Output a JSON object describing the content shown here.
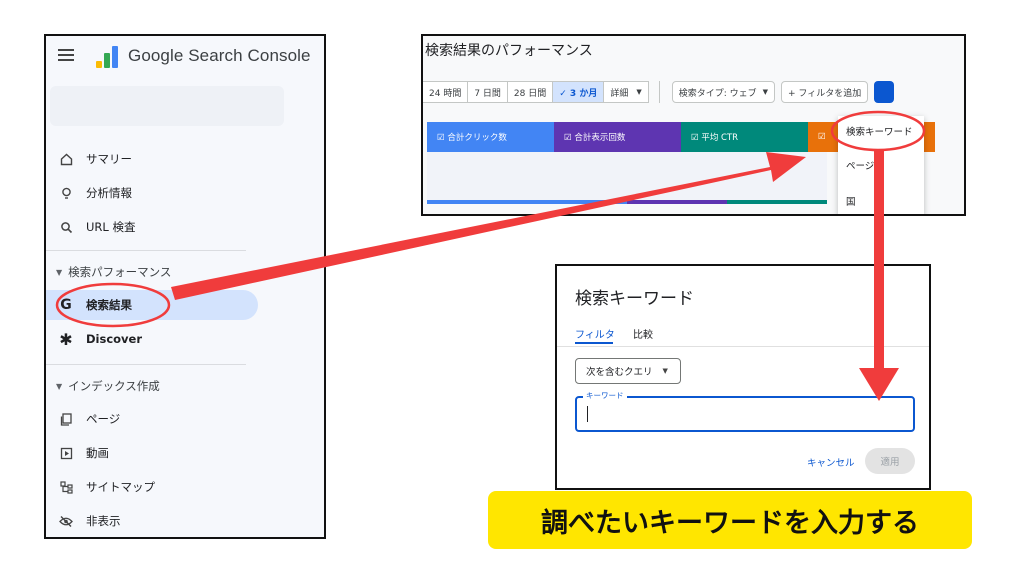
{
  "sidebar": {
    "brand": "Google Search Console",
    "items": [
      {
        "label": "サマリー",
        "icon": "home-icon"
      },
      {
        "label": "分析情報",
        "icon": "lightbulb-icon"
      },
      {
        "label": "URL 検査",
        "icon": "search-icon"
      }
    ],
    "sections": [
      {
        "label": "検索パフォーマンス"
      },
      {
        "label": "インデックス作成"
      }
    ],
    "perf_items": [
      {
        "label": "検索結果",
        "icon": "google-g-icon"
      },
      {
        "label": "Discover",
        "icon": "asterisk-icon"
      }
    ],
    "index_items": [
      {
        "label": "ページ",
        "icon": "pages-icon"
      },
      {
        "label": "動画",
        "icon": "video-icon"
      },
      {
        "label": "サイトマップ",
        "icon": "sitemap-icon"
      },
      {
        "label": "非表示",
        "icon": "hidden-icon"
      }
    ]
  },
  "performance": {
    "title": "検索結果のパフォーマンス",
    "ranges": [
      "24 時間",
      "7 日間",
      "28 日間",
      "✓ 3 か月",
      "詳細"
    ],
    "search_type": "検索タイプ: ウェブ",
    "add_filter": "+ フィルタを追加",
    "metrics": [
      {
        "label": "☑ 合計クリック数",
        "color": "#4285f4"
      },
      {
        "label": "☑ 合計表示回数",
        "color": "#5e35b1"
      },
      {
        "label": "☑ 平均 CTR",
        "color": "#00897b"
      },
      {
        "label": "☑",
        "color": "#e8710a"
      }
    ],
    "dropdown": [
      "検索キーワード",
      "ページ",
      "国"
    ]
  },
  "dialog": {
    "title": "検索キーワード",
    "tabs": [
      "フィルタ",
      "比較"
    ],
    "condition": "次を含むクエリ",
    "keyword_label": "キーワード",
    "cancel": "キャンセル",
    "apply": "適用"
  },
  "caption": "調べたいキーワードを入力する",
  "colors": {
    "annotation": "#f03c3c",
    "caption_bg": "#ffe600",
    "accent": "#0b57d0"
  }
}
